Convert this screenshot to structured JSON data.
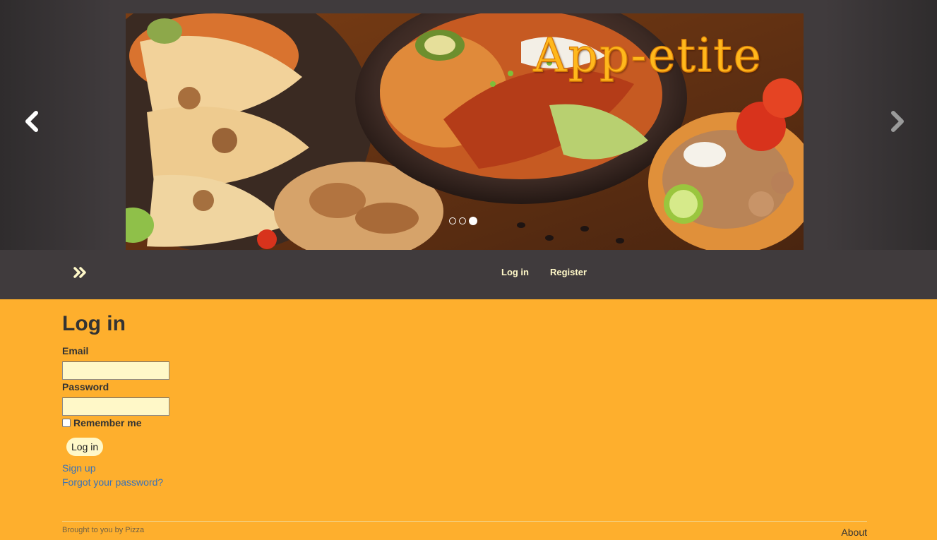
{
  "carousel": {
    "brand_title": "App-etite",
    "prev_icon": "chevron-left-icon",
    "next_icon": "chevron-right-icon",
    "slide_count": 3,
    "active_slide": 3
  },
  "navbar": {
    "toggle_icon": "double-chevron-right-icon",
    "links": [
      {
        "label": "Log in"
      },
      {
        "label": "Register"
      }
    ]
  },
  "login": {
    "title": "Log in",
    "email_label": "Email",
    "email_value": "",
    "password_label": "Password",
    "password_value": "",
    "remember_label": "Remember me",
    "remember_checked": false,
    "submit_label": "Log in",
    "signup_link": "Sign up",
    "forgot_link": "Forgot your password?"
  },
  "footer": {
    "credit": "Brought to you by Pizza",
    "about_link": "About"
  },
  "colors": {
    "page_background": "#FEAF2D",
    "navbar_background": "#403B3D",
    "nav_link": "#FFF8C8",
    "input_background": "#FFF8C8",
    "link": "#3872B8",
    "brand_title": "#FFB81C"
  }
}
